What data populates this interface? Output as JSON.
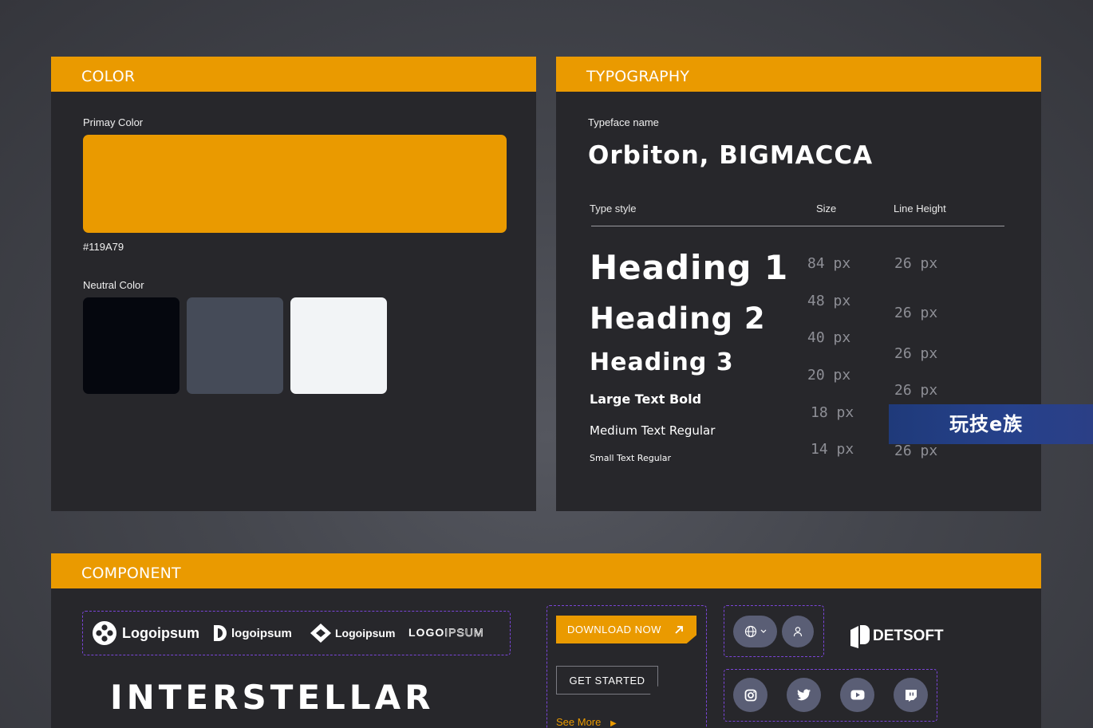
{
  "color": {
    "header": "COLOR",
    "primary_label": "Primay Color",
    "primary_hex": "#119A79",
    "primary_swatch": "#EA9A00",
    "neutral_label": "Neutral Color",
    "neutral_swatches": [
      "#05070E",
      "#454B58",
      "#F2F4F6"
    ]
  },
  "typography": {
    "header": "TYPOGRAPHY",
    "typeface_label": "Typeface name",
    "typeface": "Orbiton, BIGMACCA",
    "col_style": "Type style",
    "col_size": "Size",
    "col_line_height": "Line Height",
    "styles": [
      {
        "name": "Heading 1",
        "size": "84 px",
        "line_height": "26 px"
      },
      {
        "name": "Heading 2",
        "size": "48 px",
        "line_height": "26 px"
      },
      {
        "name": "Heading 3",
        "size": "40 px",
        "line_height": "26 px"
      },
      {
        "name": "Large Text Bold",
        "size": "20 px",
        "line_height": "26 px"
      },
      {
        "name": "Medium Text Regular",
        "size": "18 px",
        "line_height": ""
      },
      {
        "name": "Small Text Regular",
        "size": "14 px",
        "line_height": "26 px"
      }
    ]
  },
  "component": {
    "header": "COMPONENT",
    "logos": [
      "Logoipsum",
      "logoipsum",
      "Logoipsum",
      "LOGO",
      "IPSUM"
    ],
    "wordmark": "INTERSTELLAR",
    "download_label": "DOWNLOAD NOW",
    "get_started_label": "GET STARTED",
    "see_more_label": "See More",
    "brand": "DETSOFT"
  },
  "watermark": "玩技e族"
}
